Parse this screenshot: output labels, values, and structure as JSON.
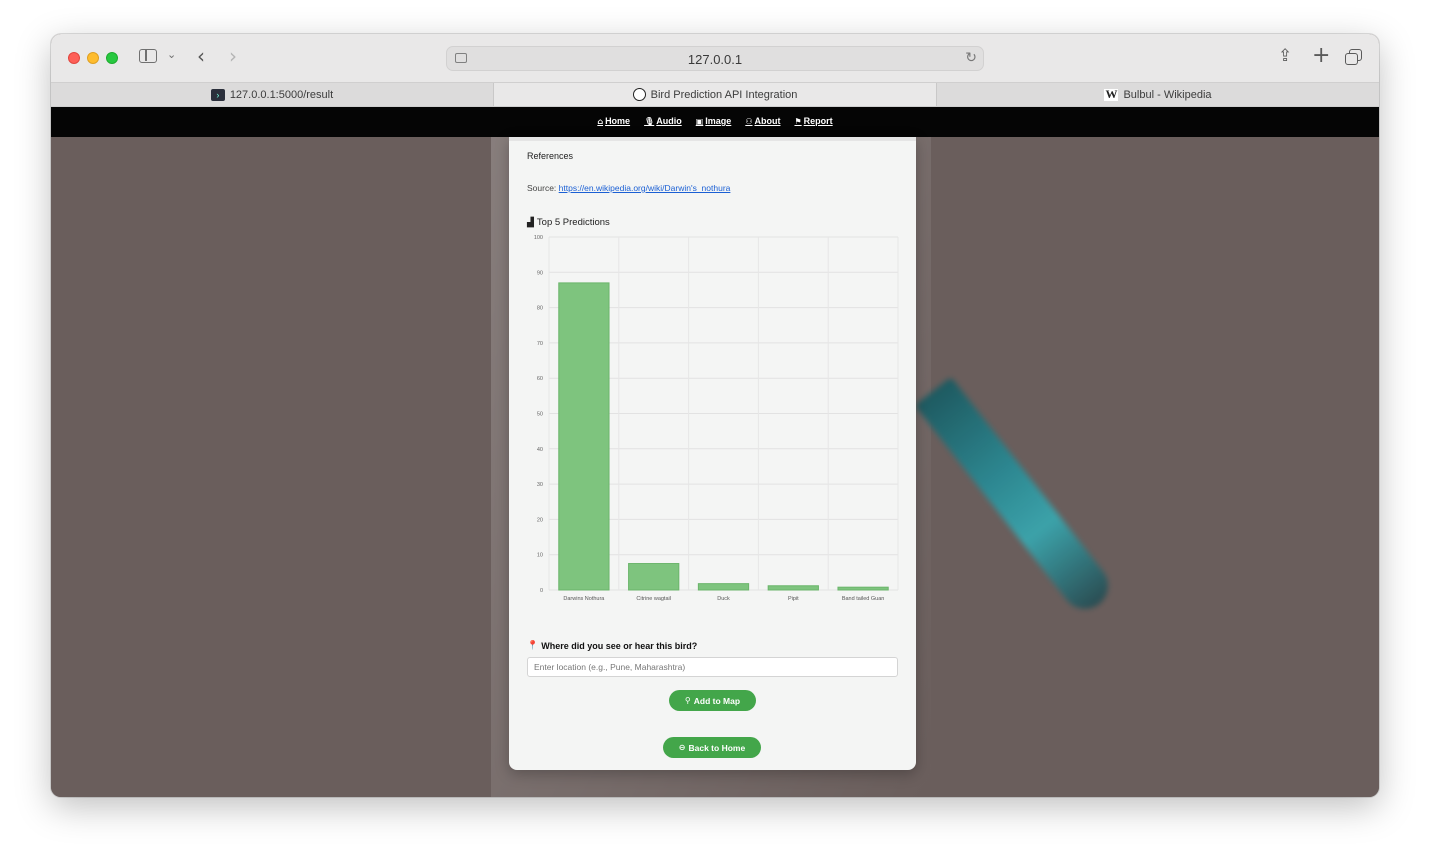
{
  "browser": {
    "address": "127.0.0.1",
    "tabs": [
      {
        "label": "127.0.0.1:5000/result",
        "icon": "terminal-icon",
        "active": false
      },
      {
        "label": "Bird Prediction API Integration",
        "icon": "openai-icon",
        "active": true
      },
      {
        "label": "Bulbul - Wikipedia",
        "icon": "wikipedia-icon",
        "active": false
      }
    ]
  },
  "nav": {
    "items": [
      {
        "label": "Home",
        "icon": "home-icon"
      },
      {
        "label": "Audio",
        "icon": "microphone-icon"
      },
      {
        "label": "Image",
        "icon": "image-icon"
      },
      {
        "label": "About",
        "icon": "users-icon"
      },
      {
        "label": "Report",
        "icon": "flag-icon"
      }
    ]
  },
  "card": {
    "references_heading": "References",
    "source_prefix": "Source:",
    "source_url": "https://en.wikipedia.org/wiki/Darwin's_nothura",
    "chart_heading": "Top 5 Predictions",
    "location_label": "Where did you see or hear this bird?",
    "location_placeholder": "Enter location (e.g., Pune, Maharashtra)",
    "add_to_map_label": "Add to Map",
    "back_home_label": "Back to Home"
  },
  "colors": {
    "bar_fill": "#7ec47e",
    "button_green": "#43a64a",
    "link_blue": "#1a5fd4"
  },
  "chart_data": {
    "type": "bar",
    "title": "Top 5 Predictions",
    "categories": [
      "Darwins Nothura",
      "Citrine wagtail",
      "Duck",
      "Pipit",
      "Band tailed Guan"
    ],
    "values": [
      87,
      7.5,
      1.8,
      1.2,
      0.8
    ],
    "ylim": [
      0,
      100
    ],
    "yticks": [
      0,
      10,
      20,
      30,
      40,
      50,
      60,
      70,
      80,
      90,
      100
    ],
    "grid": true
  }
}
